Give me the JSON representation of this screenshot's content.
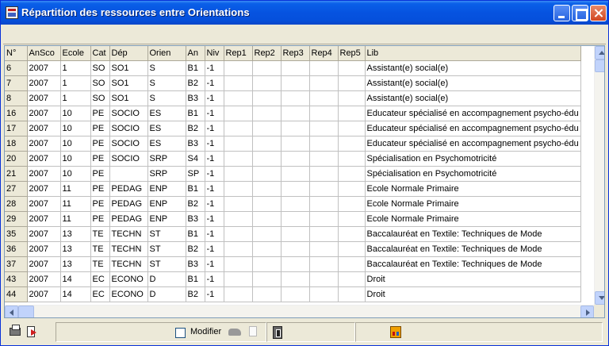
{
  "window": {
    "title": "Répartition des ressources entre Orientations"
  },
  "columns": [
    {
      "label": "N°",
      "width": 28
    },
    {
      "label": "AnSco",
      "width": 42
    },
    {
      "label": "Ecole",
      "width": 38
    },
    {
      "label": "Cat",
      "width": 24
    },
    {
      "label": "Dép",
      "width": 48
    },
    {
      "label": "Orien",
      "width": 48
    },
    {
      "label": "An",
      "width": 24
    },
    {
      "label": "Niv",
      "width": 24
    },
    {
      "label": "Rep1",
      "width": 36
    },
    {
      "label": "Rep2",
      "width": 36
    },
    {
      "label": "Rep3",
      "width": 36
    },
    {
      "label": "Rep4",
      "width": 36
    },
    {
      "label": "Rep5",
      "width": 34
    },
    {
      "label": "Lib",
      "width": 259
    }
  ],
  "rows": [
    [
      "6",
      "2007",
      "1",
      "SO",
      "SO1",
      "S",
      "B1",
      "-1",
      "",
      "",
      "",
      "",
      "",
      "Assistant(e) social(e)"
    ],
    [
      "7",
      "2007",
      "1",
      "SO",
      "SO1",
      "S",
      "B2",
      "-1",
      "",
      "",
      "",
      "",
      "",
      "Assistant(e) social(e)"
    ],
    [
      "8",
      "2007",
      "1",
      "SO",
      "SO1",
      "S",
      "B3",
      "-1",
      "",
      "",
      "",
      "",
      "",
      "Assistant(e) social(e)"
    ],
    [
      "16",
      "2007",
      "10",
      "PE",
      "SOCIO",
      "ES",
      "B1",
      "-1",
      "",
      "",
      "",
      "",
      "",
      "Educateur spécialisé en accompagnement psycho-édu"
    ],
    [
      "17",
      "2007",
      "10",
      "PE",
      "SOCIO",
      "ES",
      "B2",
      "-1",
      "",
      "",
      "",
      "",
      "",
      "Educateur spécialisé en accompagnement psycho-édu"
    ],
    [
      "18",
      "2007",
      "10",
      "PE",
      "SOCIO",
      "ES",
      "B3",
      "-1",
      "",
      "",
      "",
      "",
      "",
      "Educateur spécialisé en accompagnement psycho-édu"
    ],
    [
      "20",
      "2007",
      "10",
      "PE",
      "SOCIO",
      "SRP",
      "S4",
      "-1",
      "",
      "",
      "",
      "",
      "",
      "Spécialisation en Psychomotricité"
    ],
    [
      "21",
      "2007",
      "10",
      "PE",
      "",
      "SRP",
      "SP",
      "-1",
      "",
      "",
      "",
      "",
      "",
      "Spécialisation en Psychomotricité"
    ],
    [
      "27",
      "2007",
      "11",
      "PE",
      "PEDAG",
      "ENP",
      "B1",
      "-1",
      "",
      "",
      "",
      "",
      "",
      "Ecole Normale Primaire"
    ],
    [
      "28",
      "2007",
      "11",
      "PE",
      "PEDAG",
      "ENP",
      "B2",
      "-1",
      "",
      "",
      "",
      "",
      "",
      "Ecole Normale Primaire"
    ],
    [
      "29",
      "2007",
      "11",
      "PE",
      "PEDAG",
      "ENP",
      "B3",
      "-1",
      "",
      "",
      "",
      "",
      "",
      "Ecole Normale Primaire"
    ],
    [
      "35",
      "2007",
      "13",
      "TE",
      "TECHN",
      "ST",
      "B1",
      "-1",
      "",
      "",
      "",
      "",
      "",
      "Baccalauréat en Textile: Techniques de Mode"
    ],
    [
      "36",
      "2007",
      "13",
      "TE",
      "TECHN",
      "ST",
      "B2",
      "-1",
      "",
      "",
      "",
      "",
      "",
      "Baccalauréat en Textile: Techniques de Mode"
    ],
    [
      "37",
      "2007",
      "13",
      "TE",
      "TECHN",
      "ST",
      "B3",
      "-1",
      "",
      "",
      "",
      "",
      "",
      "Baccalauréat en Textile: Techniques de Mode"
    ],
    [
      "43",
      "2007",
      "14",
      "EC",
      "ECONO",
      "D",
      "B1",
      "-1",
      "",
      "",
      "",
      "",
      "",
      "Droit"
    ],
    [
      "44",
      "2007",
      "14",
      "EC",
      "ECONO",
      "D",
      "B2",
      "-1",
      "",
      "",
      "",
      "",
      "",
      "Droit"
    ]
  ],
  "status": {
    "modifier_label": "Modifier",
    "modifier_checked": false
  },
  "icons": {
    "app": "app-icon",
    "print": "printer-icon",
    "exit": "exit-icon",
    "car": "car-icon",
    "page": "page-icon",
    "door": "door-icon",
    "building": "building-icon"
  },
  "colors": {
    "titlebar": "#0653e0",
    "window_bg": "#ece9d8",
    "grid_line": "#c0c0c0",
    "header_bg": "#ece9d8"
  }
}
